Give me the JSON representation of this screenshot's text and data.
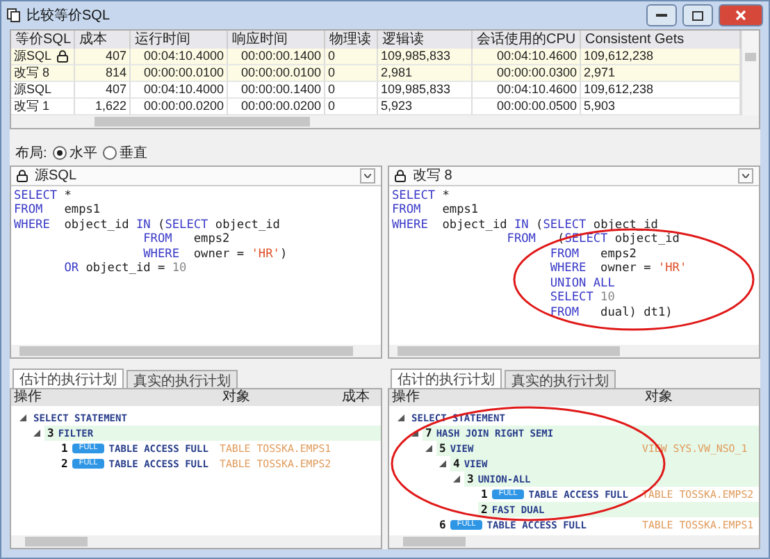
{
  "window": {
    "title": "比较等价SQL"
  },
  "grid": {
    "columns": [
      "等价SQL",
      "成本",
      "运行时间",
      "响应时间",
      "物理读",
      "逻辑读",
      "会话使用的CPU",
      "Consistent Gets"
    ],
    "rows": [
      {
        "highlighted": true,
        "locked": true,
        "cells": [
          "源SQL",
          "407",
          "00:04:10.4000",
          "00:00:00.1400",
          "0",
          "109,985,833",
          "00:04:10.4600",
          "109,612,238"
        ]
      },
      {
        "highlighted": true,
        "locked": false,
        "cells": [
          "改写 8",
          "814",
          "00:00:00.0100",
          "00:00:00.0100",
          "0",
          "2,981",
          "00:00:00.0300",
          "2,971"
        ]
      },
      {
        "highlighted": false,
        "locked": false,
        "cells": [
          "源SQL",
          "407",
          "00:04:10.4000",
          "00:00:00.1400",
          "0",
          "109,985,833",
          "00:04:10.4600",
          "109,612,238"
        ]
      },
      {
        "highlighted": false,
        "locked": false,
        "cells": [
          "改写 1",
          "1,622",
          "00:00:00.0200",
          "00:00:00.0200",
          "0",
          "5,923",
          "00:00:00.0500",
          "5,903"
        ]
      }
    ]
  },
  "layout": {
    "label": "布局:",
    "options": [
      {
        "label": "水平",
        "selected": true
      },
      {
        "label": "垂直",
        "selected": false
      }
    ]
  },
  "panes": [
    {
      "title": "源SQL",
      "lines": [
        [
          {
            "kind": "kw",
            "text": "SELECT"
          },
          {
            "kind": "id",
            "text": " *"
          }
        ],
        [
          {
            "kind": "kw",
            "text": "FROM"
          },
          {
            "kind": "id",
            "text": "   emps1"
          }
        ],
        [
          {
            "kind": "kw",
            "text": "WHERE"
          },
          {
            "kind": "id",
            "text": "  object_id "
          },
          {
            "kind": "kw",
            "text": "IN"
          },
          {
            "kind": "id",
            "text": " ("
          },
          {
            "kind": "kw",
            "text": "SELECT"
          },
          {
            "kind": "id",
            "text": " object_id"
          }
        ],
        [
          {
            "kind": "kw",
            "text": "                  FROM"
          },
          {
            "kind": "id",
            "text": "   emps2"
          }
        ],
        [
          {
            "kind": "kw",
            "text": "                  WHERE"
          },
          {
            "kind": "id",
            "text": "  owner = "
          },
          {
            "kind": "str",
            "text": "'HR'"
          },
          {
            "kind": "id",
            "text": ")"
          }
        ],
        [
          {
            "kind": "kw",
            "text": "       OR"
          },
          {
            "kind": "id",
            "text": " object_id = "
          },
          {
            "kind": "num",
            "text": "10"
          }
        ]
      ]
    },
    {
      "title": "改写 8",
      "annotated": true,
      "lines": [
        [
          {
            "kind": "kw",
            "text": "SELECT"
          },
          {
            "kind": "id",
            "text": " *"
          }
        ],
        [
          {
            "kind": "kw",
            "text": "FROM"
          },
          {
            "kind": "id",
            "text": "   emps1"
          }
        ],
        [
          {
            "kind": "kw",
            "text": "WHERE"
          },
          {
            "kind": "id",
            "text": "  object_id "
          },
          {
            "kind": "kw",
            "text": "IN"
          },
          {
            "kind": "id",
            "text": " ("
          },
          {
            "kind": "kw",
            "text": "SELECT"
          },
          {
            "kind": "id",
            "text": " object_id"
          }
        ],
        [
          {
            "kind": "kw",
            "text": "                FROM"
          },
          {
            "kind": "id",
            "text": "   ("
          },
          {
            "kind": "kw",
            "text": "SELECT"
          },
          {
            "kind": "id",
            "text": " object_id"
          }
        ],
        [
          {
            "kind": "kw",
            "text": "                      FROM"
          },
          {
            "kind": "id",
            "text": "   emps2"
          }
        ],
        [
          {
            "kind": "kw",
            "text": "                      WHERE"
          },
          {
            "kind": "id",
            "text": "  owner = "
          },
          {
            "kind": "str",
            "text": "'HR'"
          }
        ],
        [
          {
            "kind": "kw",
            "text": "                      UNION ALL"
          }
        ],
        [
          {
            "kind": "kw",
            "text": "                      SELECT "
          },
          {
            "kind": "num",
            "text": "10"
          }
        ],
        [
          {
            "kind": "kw",
            "text": "                      FROM"
          },
          {
            "kind": "id",
            "text": "   dual) dt1)"
          }
        ]
      ]
    }
  ],
  "plans": [
    {
      "tabs": [
        {
          "label": "估计的执行计划",
          "selected": true
        },
        {
          "label": "真实的执行计划",
          "selected": false
        }
      ],
      "columns": [
        "操作",
        "对象",
        "成本"
      ],
      "rows": [
        {
          "operation": "SELECT STATEMENT",
          "highlighted": false,
          "expanded": true,
          "children": [
            {
              "id": "3",
              "operation": "FILTER",
              "highlighted": true,
              "expanded": true,
              "children": [
                {
                  "id": "1",
                  "badge": "FULL",
                  "operation": "TABLE ACCESS FULL",
                  "object": "TABLE TOSSKA.EMPS1",
                  "highlighted": false
                },
                {
                  "id": "2",
                  "badge": "FULL",
                  "operation": "TABLE ACCESS FULL",
                  "object": "TABLE TOSSKA.EMPS2",
                  "highlighted": false
                }
              ]
            }
          ]
        }
      ]
    },
    {
      "tabs": [
        {
          "label": "估计的执行计划",
          "selected": true
        },
        {
          "label": "真实的执行计划",
          "selected": false
        }
      ],
      "columns": [
        "操作",
        "对象"
      ],
      "annotated": true,
      "rows": [
        {
          "operation": "SELECT STATEMENT",
          "highlighted": false,
          "expanded": true,
          "children": [
            {
              "id": "7",
              "operation": "HASH JOIN RIGHT SEMI",
              "highlighted": true,
              "expanded": true,
              "children": [
                {
                  "id": "5",
                  "operation": "VIEW",
                  "object": "VIEW SYS.VW_NSO_1",
                  "highlighted": true,
                  "expanded": true,
                  "children": [
                    {
                      "id": "4",
                      "operation": "VIEW",
                      "highlighted": true,
                      "expanded": true,
                      "children": [
                        {
                          "id": "3",
                          "operation": "UNION-ALL",
                          "highlighted": true,
                          "expanded": true,
                          "children": [
                            {
                              "id": "1",
                              "badge": "FULL",
                              "operation": "TABLE ACCESS FULL",
                              "object": "TABLE TOSSKA.EMPS2",
                              "highlighted": false
                            },
                            {
                              "id": "2",
                              "operation": "FAST DUAL",
                              "highlighted": true
                            }
                          ]
                        }
                      ]
                    }
                  ]
                },
                {
                  "id": "6",
                  "badge": "FULL",
                  "operation": "TABLE ACCESS FULL",
                  "object": "TABLE TOSSKA.EMPS1",
                  "highlighted": false
                }
              ]
            }
          ]
        }
      ]
    }
  ]
}
